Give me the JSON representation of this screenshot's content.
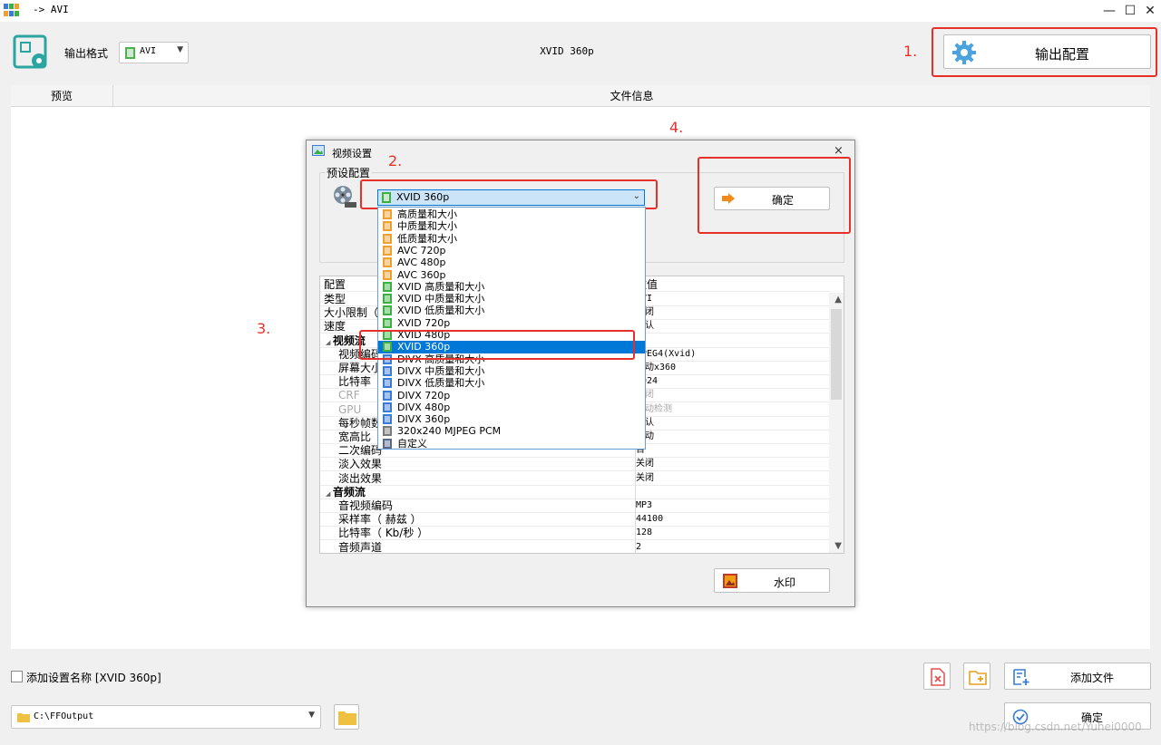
{
  "window": {
    "title": "-> AVI",
    "min": "—",
    "max": "☐",
    "close": "✕"
  },
  "toolbar": {
    "format_label": "输出格式",
    "format_value": "AVI",
    "preset_name": "XVID 360p",
    "output_config_label": "输出配置"
  },
  "columns": {
    "preview": "预览",
    "file_info": "文件信息"
  },
  "annotations": [
    "1.",
    "2.",
    "3.",
    "4."
  ],
  "dialog": {
    "title": "视频设置",
    "close": "×",
    "preset_group_label": "预设配置",
    "preset_selected": "XVID 360p",
    "ok_label": "确定",
    "watermark_label": "水印",
    "grid_header": {
      "key": "配置",
      "value": "数值"
    },
    "grid_rows": [
      {
        "k": "类型",
        "v": "AVI",
        "kind": ""
      },
      {
        "k": "大小限制（",
        "v": "关闭",
        "kind": ""
      },
      {
        "k": "速度",
        "v": "默认",
        "kind": ""
      },
      {
        "k": "视频流",
        "v": "",
        "kind": "section"
      },
      {
        "k": "视频编码",
        "v": "MPEG4(Xvid)",
        "kind": "sub"
      },
      {
        "k": "屏幕大小",
        "v": "自动x360",
        "kind": "sub"
      },
      {
        "k": "比特率（",
        "v": "1024",
        "kind": "sub"
      },
      {
        "k": "CRF",
        "v": "关闭",
        "kind": "sub dim"
      },
      {
        "k": "GPU",
        "v": "自动检测",
        "kind": "sub dim"
      },
      {
        "k": "每秒帧数",
        "v": "默认",
        "kind": "sub"
      },
      {
        "k": "宽高比",
        "v": "自动",
        "kind": "sub"
      },
      {
        "k": "二次编码",
        "v": "否",
        "kind": "sub"
      },
      {
        "k": "淡入效果",
        "v": "关闭",
        "kind": "sub"
      },
      {
        "k": "淡出效果",
        "v": "关闭",
        "kind": "sub"
      },
      {
        "k": "音频流",
        "v": "",
        "kind": "section"
      },
      {
        "k": "音视频编码",
        "v": "MP3",
        "kind": "sub"
      },
      {
        "k": "采样率（ 赫兹 ）",
        "v": "44100",
        "kind": "sub"
      },
      {
        "k": "比特率（ Kb/秒 ）",
        "v": "128",
        "kind": "sub"
      },
      {
        "k": "音频声道",
        "v": "2",
        "kind": "sub"
      }
    ],
    "dropdown_items": [
      {
        "label": "高质量和大小",
        "color": "#f0a030"
      },
      {
        "label": "中质量和大小",
        "color": "#f0a030"
      },
      {
        "label": "低质量和大小",
        "color": "#f0a030"
      },
      {
        "label": "AVC 720p",
        "color": "#f0a030"
      },
      {
        "label": "AVC 480p",
        "color": "#f0a030"
      },
      {
        "label": "AVC 360p",
        "color": "#f0a030"
      },
      {
        "label": "XVID 高质量和大小",
        "color": "#3cb043"
      },
      {
        "label": "XVID 中质量和大小",
        "color": "#3cb043"
      },
      {
        "label": "XVID 低质量和大小",
        "color": "#3cb043"
      },
      {
        "label": "XVID 720p",
        "color": "#3cb043"
      },
      {
        "label": "XVID 480p",
        "color": "#3cb043"
      },
      {
        "label": "XVID 360p",
        "color": "#3cb043",
        "selected": true
      },
      {
        "label": "DIVX 高质量和大小",
        "color": "#3a7bd5"
      },
      {
        "label": "DIVX 中质量和大小",
        "color": "#3a7bd5"
      },
      {
        "label": "DIVX 低质量和大小",
        "color": "#3a7bd5"
      },
      {
        "label": "DIVX 720p",
        "color": "#3a7bd5"
      },
      {
        "label": "DIVX 480p",
        "color": "#3a7bd5"
      },
      {
        "label": "DIVX 360p",
        "color": "#3a7bd5"
      },
      {
        "label": "320x240 MJPEG PCM",
        "color": "#7a7a7a"
      },
      {
        "label": "自定义",
        "color": "#5a6a8a"
      }
    ]
  },
  "bottom": {
    "add_preset_name_label": "添加设置名称 [XVID 360p]",
    "add_file_label": "添加文件",
    "output_dir": "C:\\FFOutput",
    "confirm_label": "确定",
    "watermark_text": "https://blog.csdn.net/Yuhei0000"
  },
  "colors": {
    "accent": "#0078d7",
    "annotation": "#e8302a",
    "logo": "#2aa5a0",
    "gear": "#4aa3df"
  }
}
